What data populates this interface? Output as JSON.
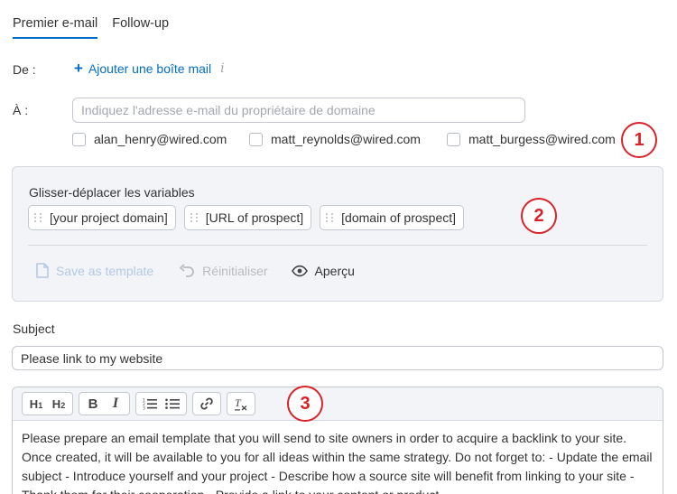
{
  "tabs": [
    {
      "label": "Premier e-mail",
      "active": true
    },
    {
      "label": "Follow-up",
      "active": false
    }
  ],
  "from": {
    "label": "De :",
    "add_mailbox": "Ajouter une boîte mail",
    "info_icon": "i"
  },
  "to": {
    "label": "À :",
    "placeholder": "Indiquez l'adresse e-mail du propriétaire de domaine",
    "value": "",
    "suggestions": [
      {
        "email": "alan_henry@wired.com",
        "checked": false
      },
      {
        "email": "matt_reynolds@wired.com",
        "checked": false
      },
      {
        "email": "matt_burgess@wired.com",
        "checked": false
      }
    ]
  },
  "variables": {
    "title": "Glisser-déplacer les variables",
    "chips": [
      "[your project domain]",
      "[URL of prospect]",
      "[domain of prospect]"
    ],
    "actions": {
      "save_template": "Save as template",
      "reset": "Réinitialiser",
      "preview": "Aperçu"
    }
  },
  "subject": {
    "label": "Subject",
    "value": "Please link to my website"
  },
  "editor": {
    "toolbar": {
      "h1": "H",
      "h1_sub": "1",
      "h2": "H",
      "h2_sub": "2",
      "bold": "B",
      "italic": "I",
      "clear": "T"
    },
    "body": "Please prepare an email template that you will send to site owners in order to acquire a backlink to your site. Once created, it will be available to you for all ideas within the same strategy. Do not forget to: - Update the email subject - Introduce yourself and your project - Describe how a source site will benefit from linking to your site - Thank them for their cooperation - Provide a link to your content or product"
  },
  "annotations": [
    "1",
    "2",
    "3"
  ],
  "colors": {
    "accent": "#006dca",
    "annotation": "#d8232a",
    "panel_bg": "#f3f4f8",
    "disabled_link": "#b3c8e4"
  },
  "icons": {
    "add": "plus-icon",
    "info": "info-icon",
    "save_template": "file-icon",
    "reset": "undo-icon",
    "preview": "eye-icon",
    "link": "link-icon",
    "ordered_list": "ordered-list-icon",
    "bullet_list": "bullet-list-icon",
    "clear_format": "clear-format-icon",
    "drag_handle": "drag-handle-icon"
  }
}
